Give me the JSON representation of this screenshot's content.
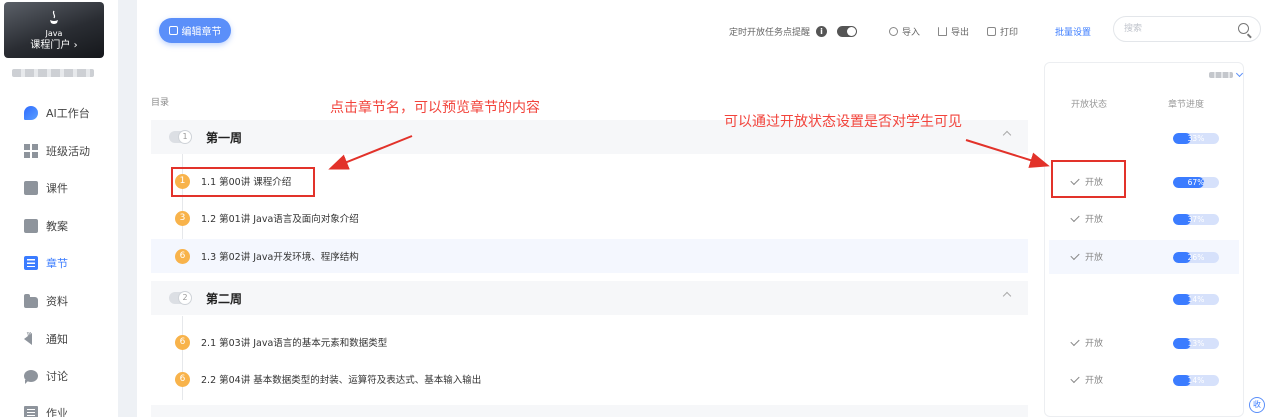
{
  "sidebar": {
    "course": {
      "logo_text": "Java",
      "portal_link": "课程门户 ›"
    },
    "items": [
      {
        "label": "AI工作台",
        "icon": "ai-workbench-icon"
      },
      {
        "label": "班级活动",
        "icon": "grid-icon"
      },
      {
        "label": "课件",
        "icon": "courseware-icon"
      },
      {
        "label": "教案",
        "icon": "lesson-plan-icon"
      },
      {
        "label": "章节",
        "icon": "chapter-list-icon",
        "active": true
      },
      {
        "label": "资料",
        "icon": "folder-icon"
      },
      {
        "label": "通知",
        "icon": "speaker-icon"
      },
      {
        "label": "讨论",
        "icon": "chat-icon"
      },
      {
        "label": "作业",
        "icon": "homework-icon"
      }
    ]
  },
  "toolbar": {
    "edit_label": "编辑章节",
    "reminder_label": "定时开放任务点提醒",
    "import_label": "导入",
    "export_label": "导出",
    "print_label": "打印",
    "batch_label": "批量设置",
    "search_placeholder": "搜索"
  },
  "catalog": {
    "label": "目录",
    "weeks": [
      {
        "number": "1",
        "title": "第一周",
        "progress": 33,
        "lessons": [
          {
            "badge": "1",
            "title": "1.1 第00讲 课程介绍",
            "status": "开放",
            "progress": 67
          },
          {
            "badge": "3",
            "title": "1.2 第01讲 Java语言及面向对象介绍",
            "status": "开放",
            "progress": 37
          },
          {
            "badge": "6",
            "title": "1.3 第02讲 Java开发环境、程序结构",
            "status": "开放",
            "progress": 26
          }
        ]
      },
      {
        "number": "2",
        "title": "第二周",
        "progress": 14,
        "lessons": [
          {
            "badge": "6",
            "title": "2.1 第03讲 Java语言的基本元素和数据类型",
            "status": "开放",
            "progress": 13
          },
          {
            "badge": "6",
            "title": "2.2 第04讲 基本数据类型的封装、运算符及表达式、基本输入输出",
            "status": "开放",
            "progress": 14
          }
        ]
      }
    ]
  },
  "status_panel": {
    "open_status_header": "开放状态",
    "progress_header": "章节进度"
  },
  "annotations": {
    "chapter_hint": "点击章节名，可以预览章节的内容",
    "status_hint": "可以通过开放状态设置是否对学生可见"
  },
  "collapse_label": "收",
  "colors": {
    "accent": "#3b7cff",
    "badge": "#f8b34b",
    "annotation": "#f2443c"
  }
}
